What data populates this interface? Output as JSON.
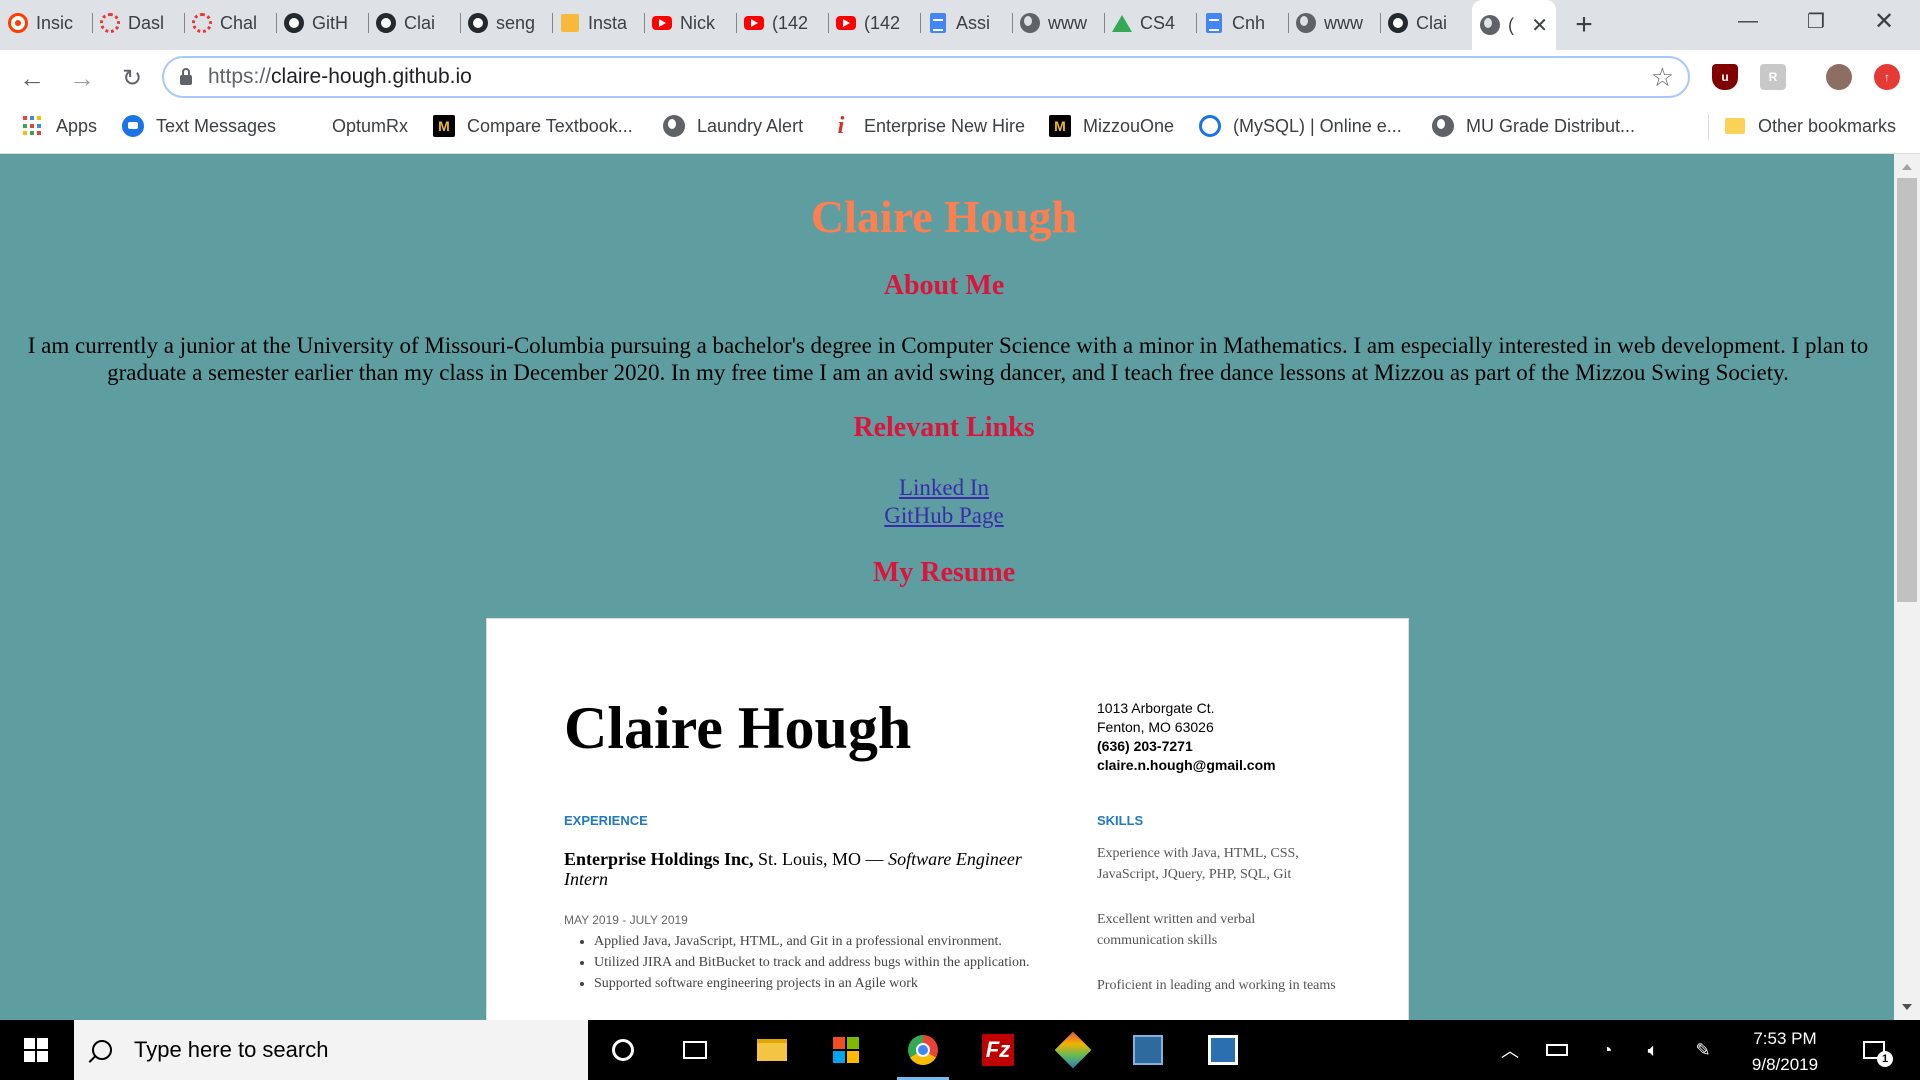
{
  "browser": {
    "tabs": [
      {
        "title": "Insic",
        "icon": "target-icon"
      },
      {
        "title": "Dasl",
        "icon": "canvas-icon"
      },
      {
        "title": "Chal",
        "icon": "canvas-icon"
      },
      {
        "title": "GitH",
        "icon": "github-icon"
      },
      {
        "title": "Clai",
        "icon": "github-icon"
      },
      {
        "title": "seng",
        "icon": "github-icon"
      },
      {
        "title": "Insta",
        "icon": "box-icon"
      },
      {
        "title": "Nick",
        "icon": "youtube-icon"
      },
      {
        "title": "(142",
        "icon": "youtube-icon"
      },
      {
        "title": "(142",
        "icon": "youtube-icon"
      },
      {
        "title": "Assi",
        "icon": "docs-icon"
      },
      {
        "title": "www",
        "icon": "globe-icon"
      },
      {
        "title": "CS4",
        "icon": "drive-icon"
      },
      {
        "title": "Cnh",
        "icon": "docs-icon"
      },
      {
        "title": "www",
        "icon": "globe-icon"
      },
      {
        "title": "Clai",
        "icon": "github-icon"
      }
    ],
    "active_tab": {
      "title": "(",
      "icon": "globe-icon"
    },
    "new_tab_symbol": "+",
    "url_prefix": "https://",
    "url_host": "claire-hough.github.io"
  },
  "bookmarks": [
    {
      "label": "Apps",
      "icon": "apps-grid-icon"
    },
    {
      "label": "Text Messages",
      "icon": "messages-icon"
    },
    {
      "label": "OptumRx",
      "icon": ""
    },
    {
      "label": "Compare Textbook...",
      "icon": "mizzou-icon"
    },
    {
      "label": "Laundry Alert",
      "icon": "globe-icon"
    },
    {
      "label": "Enterprise New Hire",
      "icon": "info-i-icon"
    },
    {
      "label": "MizzouOne",
      "icon": "mizzou-icon"
    },
    {
      "label": "(MySQL) | Online e...",
      "icon": "mysql-icon"
    },
    {
      "label": "MU Grade Distribut...",
      "icon": "globe-icon"
    },
    {
      "label": "Other bookmarks",
      "icon": "folder-icon"
    }
  ],
  "page": {
    "title": "Claire Hough",
    "about_heading": "About Me",
    "about_text": "I am currently a junior at the University of Missouri-Columbia pursuing a bachelor's degree in Computer Science with a minor in Mathematics. I am especially interested in web development. I plan to graduate a semester earlier than my class in December 2020. In my free time I am an avid swing dancer, and I teach free dance lessons at Mizzou as part of the Mizzou Swing Society.",
    "links_heading": "Relevant Links",
    "links": [
      "Linked In",
      "GitHub Page"
    ],
    "resume_heading": "My Resume"
  },
  "resume": {
    "name": "Claire Hough",
    "address_line1": "1013 Arborgate Ct.",
    "address_line2": "Fenton, MO 63026",
    "phone": "(636) 203-7271",
    "email": "claire.n.hough@gmail.com",
    "experience_label": "EXPERIENCE",
    "skills_label": "SKILLS",
    "job_company": "Enterprise Holdings Inc,",
    "job_location": " St. Louis, MO — ",
    "job_role": "Software Engineer Intern",
    "job_dates": "MAY 2019 - JULY 2019",
    "bullets": [
      "Applied Java, JavaScript, HTML, and Git in a professional environment.",
      "Utilized JIRA and BitBucket to track and address bugs within the application.",
      "Supported software engineering projects in an Agile work"
    ],
    "skills": [
      "Experience with Java, HTML, CSS, JavaScript, JQuery, PHP, SQL, Git",
      "Excellent written and verbal communication skills",
      "Proficient in leading and working in teams"
    ]
  },
  "taskbar": {
    "search_placeholder": "Type here to search",
    "time": "7:53 PM",
    "date": "9/8/2019",
    "notification_count": "1"
  }
}
